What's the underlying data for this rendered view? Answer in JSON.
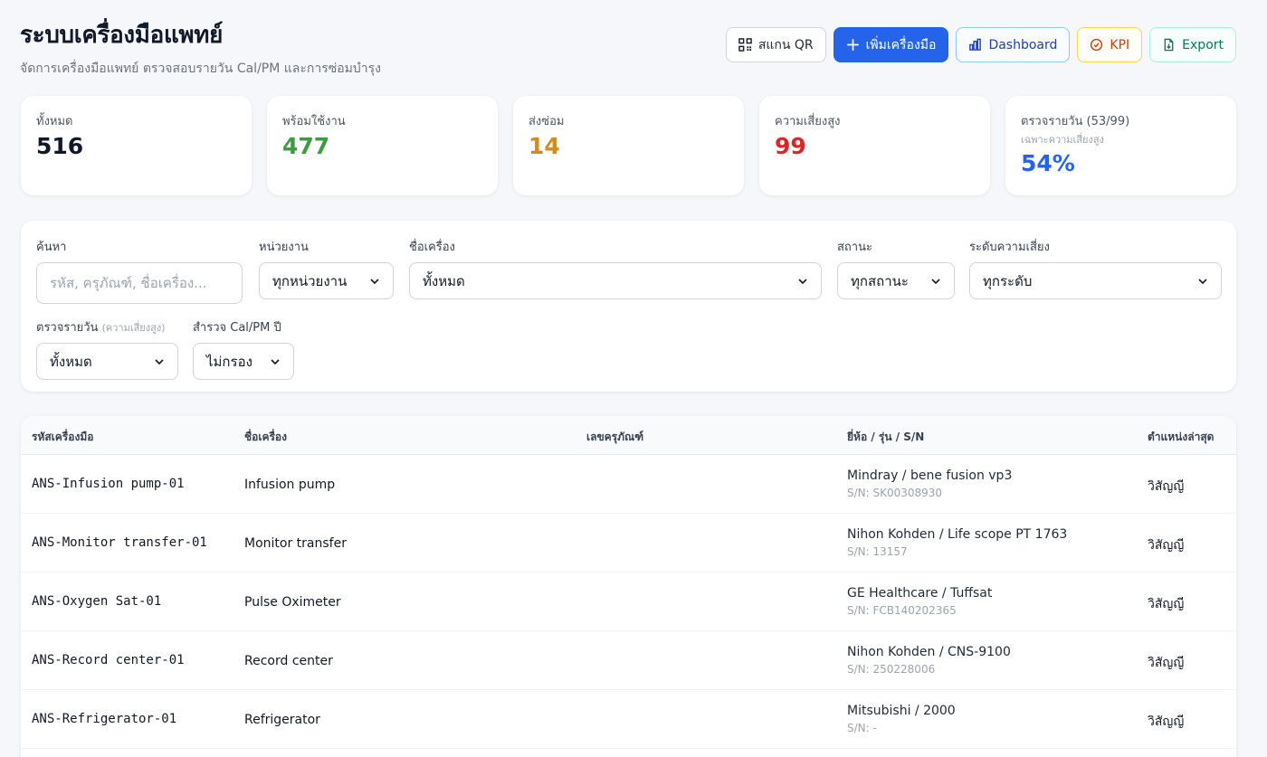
{
  "header": {
    "title": "ระบบเครื่องมือแพทย์",
    "subtitle": "จัดการเครื่องมือแพทย์ ตรวจสอบรายวัน Cal/PM และการซ่อมบำรุง"
  },
  "actions": {
    "scan_qr": "สแกน QR",
    "add_device": "เพิ่มเครื่องมือ",
    "dashboard": "Dashboard",
    "kpi": "KPI",
    "export": "Export"
  },
  "stats": {
    "total": {
      "label": "ทั้งหมด",
      "value": "516",
      "color": "#111827"
    },
    "ready": {
      "label": "พร้อมใช้งาน",
      "value": "477",
      "color": "#3f9b3f"
    },
    "repair": {
      "label": "ส่งซ่อม",
      "value": "14",
      "color": "#d18b1e"
    },
    "high_risk": {
      "label": "ความเสี่ยงสูง",
      "value": "99",
      "color": "#dc2626"
    },
    "daily_check": {
      "label": "ตรวจรายวัน (53/99)",
      "sub": "เฉพาะความเสี่ยงสูง",
      "value": "54%",
      "color": "#2563eb"
    }
  },
  "filters": {
    "search": {
      "label": "ค้นหา",
      "placeholder": "รหัส, ครุภัณฑ์, ชื่อเครื่อง..."
    },
    "unit": {
      "label": "หน่วยงาน",
      "value": "ทุกหน่วยงาน"
    },
    "device_name": {
      "label": "ชื่อเครื่อง",
      "value": "ทั้งหมด"
    },
    "status": {
      "label": "สถานะ",
      "value": "ทุกสถานะ"
    },
    "risk": {
      "label": "ระดับความเสี่ยง",
      "value": "ทุกระดับ"
    },
    "daily": {
      "label": "ตรวจรายวัน",
      "label_note": "(ความเสี่ยงสูง)",
      "value": "ทั้งหมด"
    },
    "cal_pm": {
      "label": "สำรวจ Cal/PM ปี",
      "value": "ไม่กรอง"
    }
  },
  "table": {
    "columns": [
      "รหัสเครื่องมือ",
      "ชื่อเครื่อง",
      "เลขครุภัณฑ์",
      "ยี่ห้อ / รุ่น / S/N",
      "ตำแหน่งล่าสุด"
    ],
    "rows": [
      {
        "code": "ANS-Infusion pump-01",
        "name": "Infusion pump",
        "asset": "",
        "brand": "Mindray / bene fusion vp3",
        "sn": "S/N: SK00308930",
        "location": "วิสัญญี"
      },
      {
        "code": "ANS-Monitor transfer-01",
        "name": "Monitor transfer",
        "asset": "",
        "brand": "Nihon Kohden / Life scope PT 1763",
        "sn": "S/N: 13157",
        "location": "วิสัญญี"
      },
      {
        "code": "ANS-Oxygen Sat-01",
        "name": "Pulse Oximeter",
        "asset": "",
        "brand": "GE Healthcare / Tuffsat",
        "sn": "S/N: FCB140202365",
        "location": "วิสัญญี"
      },
      {
        "code": "ANS-Record center-01",
        "name": "Record center",
        "asset": "",
        "brand": "Nihon Kohden / CNS-9100",
        "sn": "S/N: 250228006",
        "location": "วิสัญญี"
      },
      {
        "code": "ANS-Refrigerator-01",
        "name": "Refrigerator",
        "asset": "",
        "brand": "Mitsubishi / 2000",
        "sn": "S/N: -",
        "location": "วิสัญญี"
      }
    ]
  }
}
